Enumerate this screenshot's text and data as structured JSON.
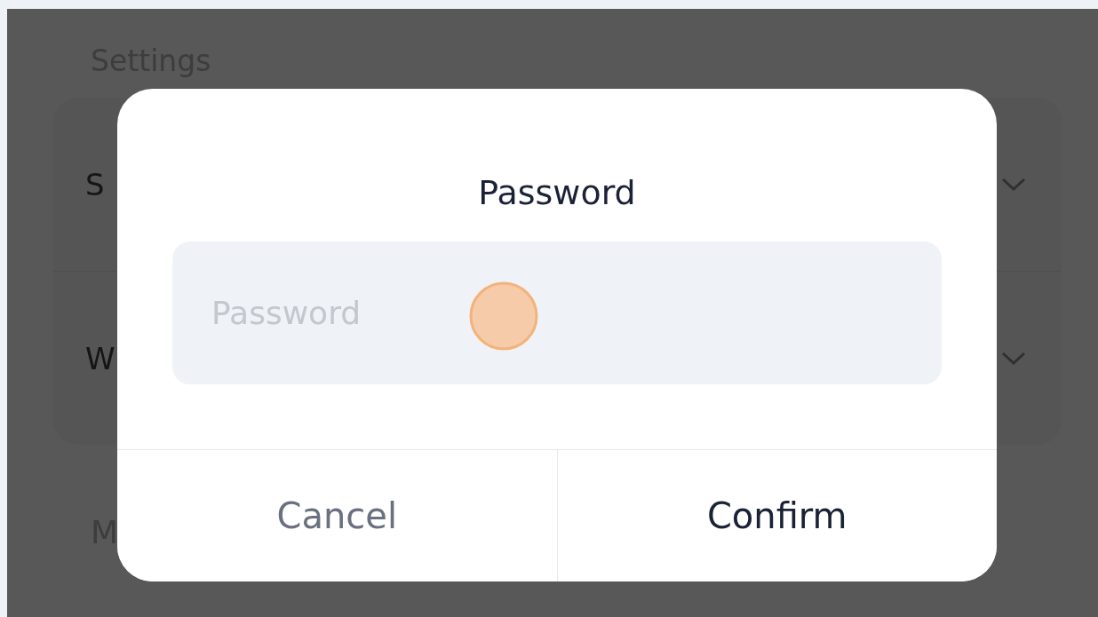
{
  "settings": {
    "section_title": "Settings",
    "rows": [
      {
        "label": "S"
      },
      {
        "label": "W"
      }
    ],
    "next_section_title": "M"
  },
  "dialog": {
    "title": "Password",
    "field": {
      "placeholder": "Password"
    },
    "buttons": [
      {
        "label": "Cancel",
        "kind": "secondary"
      },
      {
        "label": "Confirm",
        "kind": "primary"
      }
    ]
  }
}
